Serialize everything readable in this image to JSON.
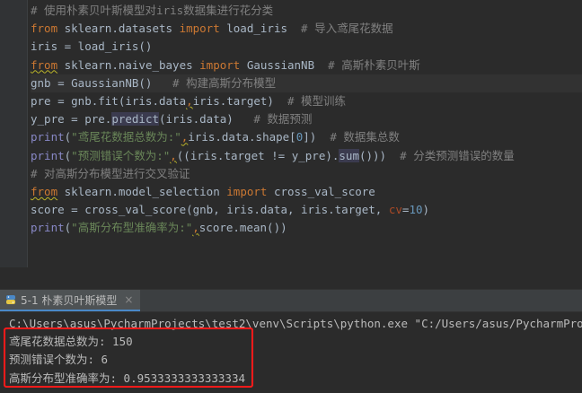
{
  "editor": {
    "lines": [
      {
        "segments": [
          {
            "t": "# 使用朴素贝叶斯模型对iris数据集进行花分类",
            "c": "cmt"
          }
        ]
      },
      {
        "segments": [
          {
            "t": "from",
            "c": "kw"
          },
          {
            "t": " sklearn.datasets ",
            "c": "plain"
          },
          {
            "t": "import",
            "c": "kw"
          },
          {
            "t": " load_iris  ",
            "c": "plain"
          },
          {
            "t": "# 导入鸢尾花数据",
            "c": "cmt"
          }
        ]
      },
      {
        "segments": [
          {
            "t": "iris = load_iris()",
            "c": "plain"
          }
        ]
      },
      {
        "segments": [
          {
            "t": "from",
            "c": "kw squiggle"
          },
          {
            "t": " sklearn.naive_bayes ",
            "c": "plain"
          },
          {
            "t": "import",
            "c": "kw"
          },
          {
            "t": " GaussianNB  ",
            "c": "plain"
          },
          {
            "t": "# 高斯朴素贝叶斯",
            "c": "cmt"
          }
        ]
      },
      {
        "segments": [
          {
            "t": "gnb = GaussianNB()   ",
            "c": "plain"
          },
          {
            "t": "# 构建高斯分布模型",
            "c": "cmt"
          }
        ],
        "current": true
      },
      {
        "segments": [
          {
            "t": "pre = gnb.fit(iris.data",
            "c": "plain"
          },
          {
            "t": ",",
            "c": "kw squiggle"
          },
          {
            "t": "iris.target)  ",
            "c": "plain"
          },
          {
            "t": "# 模型训练",
            "c": "cmt"
          }
        ]
      },
      {
        "segments": [
          {
            "t": "y_pre = pre.",
            "c": "plain"
          },
          {
            "t": "predict",
            "c": "plain hl"
          },
          {
            "t": "(iris.data)   ",
            "c": "plain"
          },
          {
            "t": "# 数据预测",
            "c": "cmt"
          }
        ]
      },
      {
        "segments": [
          {
            "t": "print",
            "c": "builtin"
          },
          {
            "t": "(",
            "c": "plain"
          },
          {
            "t": "\"鸢尾花数据总数为:\"",
            "c": "str"
          },
          {
            "t": ",",
            "c": "kw squiggle"
          },
          {
            "t": "iris.data.shape[",
            "c": "plain"
          },
          {
            "t": "0",
            "c": "num"
          },
          {
            "t": "])  ",
            "c": "plain"
          },
          {
            "t": "# 数据集总数",
            "c": "cmt"
          }
        ]
      },
      {
        "segments": [
          {
            "t": "print",
            "c": "builtin"
          },
          {
            "t": "(",
            "c": "plain"
          },
          {
            "t": "\"预测错误个数为:\"",
            "c": "str"
          },
          {
            "t": ",",
            "c": "kw squiggle"
          },
          {
            "t": "((iris.target != y_pre).",
            "c": "plain"
          },
          {
            "t": "sum",
            "c": "plain hl"
          },
          {
            "t": "()))  ",
            "c": "plain"
          },
          {
            "t": "# 分类预测错误的数量",
            "c": "cmt"
          }
        ]
      },
      {
        "segments": [
          {
            "t": "# 对高斯分布模型进行交叉验证",
            "c": "cmt"
          }
        ]
      },
      {
        "segments": [
          {
            "t": "from",
            "c": "kw squiggle"
          },
          {
            "t": " sklearn.model_selection ",
            "c": "plain"
          },
          {
            "t": "import",
            "c": "kw"
          },
          {
            "t": " cross_val_score",
            "c": "plain"
          }
        ]
      },
      {
        "segments": [
          {
            "t": "score = cross_val_score(gnb, iris.data, iris.target, ",
            "c": "plain"
          },
          {
            "t": "cv",
            "c": "param"
          },
          {
            "t": "=",
            "c": "plain"
          },
          {
            "t": "10",
            "c": "num"
          },
          {
            "t": ")",
            "c": "plain"
          }
        ]
      },
      {
        "segments": [
          {
            "t": "print",
            "c": "builtin"
          },
          {
            "t": "(",
            "c": "plain"
          },
          {
            "t": "\"高斯分布型准确率为:\"",
            "c": "str"
          },
          {
            "t": ",",
            "c": "kw squiggle"
          },
          {
            "t": "score.mean())",
            "c": "plain"
          }
        ]
      }
    ]
  },
  "run_panel": {
    "tab_label": "5-1 朴素贝叶斯模型",
    "tab_icon": "python-file-icon",
    "close_glyph": "×",
    "console": {
      "command": "C:\\Users\\asus\\PycharmProjects\\test2\\venv\\Scripts\\python.exe \"C:/Users/asus/PycharmProjects/",
      "output": [
        "鸢尾花数据总数为: 150",
        "预测错误个数为: 6",
        "高斯分布型准确率为: 0.9533333333333334"
      ]
    },
    "highlight_color": "#ff1a1a"
  }
}
